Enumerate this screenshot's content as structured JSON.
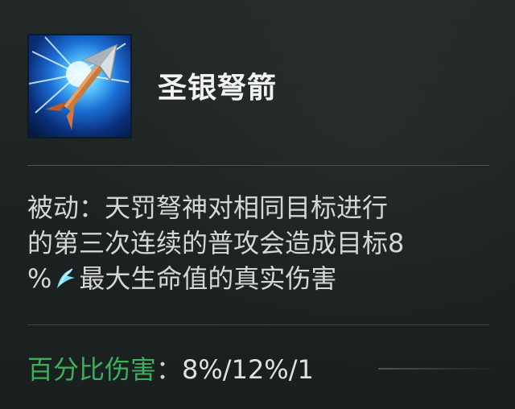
{
  "skill": {
    "name": "圣银弩箭",
    "icon": "silver-crossbow-bolt-icon"
  },
  "description": {
    "line1": "被动：天罚弩神对相同目标进行",
    "line2": "的第三次连续的普攻会造成目标8",
    "line3_prefix": "%",
    "line3_icon": "true-damage-icon",
    "line3_suffix": "最大生命值的真实伤害"
  },
  "stat": {
    "label": "百分比伤害",
    "separator": "：",
    "values": "8%/12%/1"
  },
  "colors": {
    "stat_label": "#3fae5a",
    "true_damage_icon": "#7ee0ff",
    "skill_name": "#f2f2ee"
  }
}
